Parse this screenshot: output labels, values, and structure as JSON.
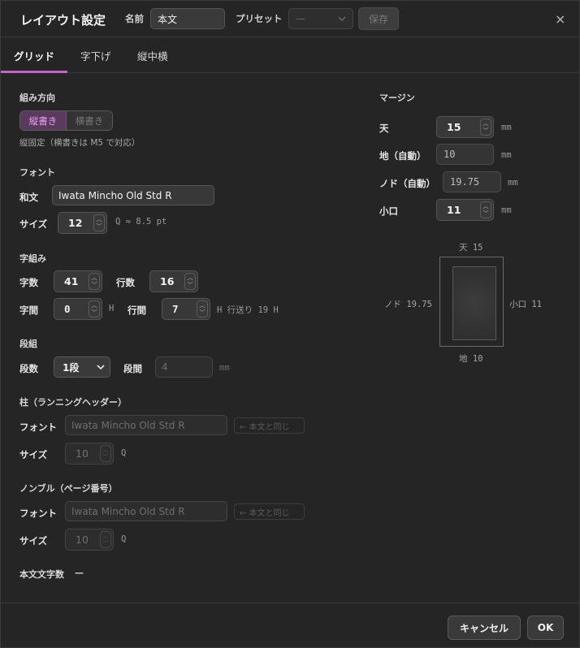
{
  "header": {
    "title": "レイアウト設定",
    "name_label": "名前",
    "name_value": "本文",
    "preset_label": "プリセット",
    "preset_value": "—",
    "save_label": "保存",
    "close_glyph": "×"
  },
  "tabs": [
    "グリッド",
    "字下げ",
    "縦中横"
  ],
  "direction": {
    "section": "組み方向",
    "options": [
      "縦書き",
      "横書き"
    ],
    "selected": "縦書き",
    "note": "縦固定（横書きは M5 で対応）"
  },
  "font": {
    "section": "フォント",
    "wabun_label": "和文",
    "wabun_value": "Iwata Mincho Old Std R",
    "size_label": "サイズ",
    "size_value": "12",
    "size_note": "Q ≈ 8.5 pt"
  },
  "kumi": {
    "section": "字組み",
    "chars_label": "字数",
    "chars_value": "41",
    "lines_label": "行数",
    "lines_value": "16",
    "jikan_label": "字間",
    "jikan_value": "0",
    "jikan_unit": "H",
    "gyokan_label": "行間",
    "gyokan_value": "7",
    "gyokan_note": "H 行送り 19 H"
  },
  "columns": {
    "section": "段組",
    "count_label": "段数",
    "count_value": "1段",
    "gap_label": "段間",
    "gap_value": "4",
    "gap_unit": "mm"
  },
  "running_head": {
    "section": "柱（ランニングヘッダー）",
    "font_label": "フォント",
    "font_value": "Iwata Mincho Old Std R",
    "same_button": "← 本文と同じ",
    "size_label": "サイズ",
    "size_value": "10",
    "size_unit": "Q"
  },
  "nombre": {
    "section": "ノンブル（ページ番号）",
    "font_label": "フォント",
    "font_value": "Iwata Mincho Old Std R",
    "same_button": "← 本文と同じ",
    "size_label": "サイズ",
    "size_value": "10",
    "size_unit": "Q"
  },
  "char_count": {
    "label": "本文文字数",
    "value": "—"
  },
  "margin": {
    "section": "マージン",
    "ten_label": "天",
    "ten_value": "15",
    "chi_label": "地（自動）",
    "chi_value": "10",
    "nodo_label": "ノド（自動）",
    "nodo_value": "19.75",
    "koguchi_label": "小口",
    "koguchi_value": "11",
    "unit": "mm"
  },
  "preview": {
    "top": "天 15",
    "bottom": "地 10",
    "left": "ノド 19.75",
    "right": "小口 11"
  },
  "footer": {
    "cancel_label": "キャンセル",
    "ok_label": "OK"
  },
  "colors": {
    "accent": "#c466c9",
    "background": "#252525"
  }
}
